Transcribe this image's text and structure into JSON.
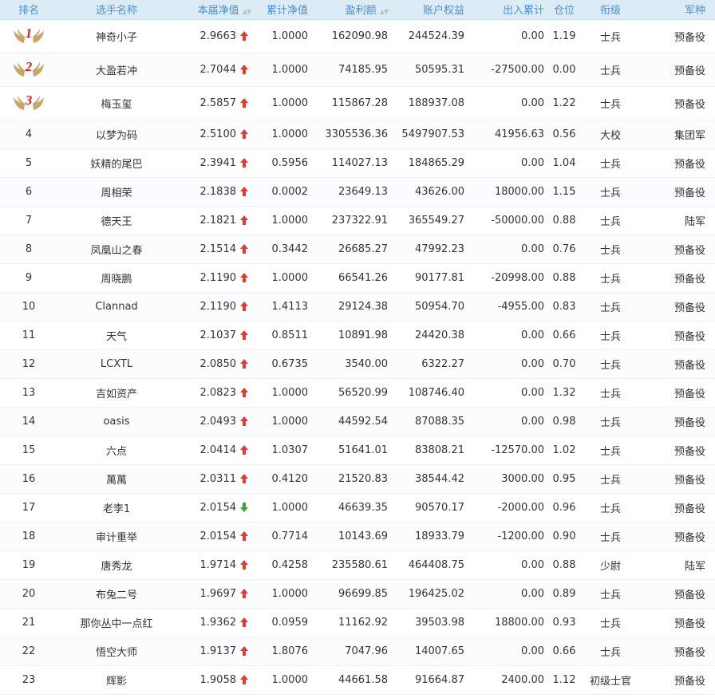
{
  "headers": {
    "rank": "排名",
    "name": "选手名称",
    "net_value": "本届净值",
    "cum_net_value": "累计净值",
    "profit": "盈利额",
    "equity": "账户权益",
    "inout": "出入累计",
    "position": "仓位",
    "title": "衔级",
    "army": "军种"
  },
  "colors": {
    "header_bg": "#dcecf7",
    "header_text": "#4a8fd6",
    "up_arrow": "#e8392a",
    "down_arrow": "#3aa53a",
    "medal": "#c9a56a",
    "medal_number": "#d02020"
  },
  "rows": [
    {
      "rank": "1",
      "name": "神奇小子",
      "net": "2.9663",
      "trend": "up",
      "cum": "1.0000",
      "profit": "162090.98",
      "equity": "244524.39",
      "inout": "0.00",
      "position": "1.19",
      "title": "士兵",
      "army": "预备役"
    },
    {
      "rank": "2",
      "name": "大盈若冲",
      "net": "2.7044",
      "trend": "up",
      "cum": "1.0000",
      "profit": "74185.95",
      "equity": "50595.31",
      "inout": "-27500.00",
      "position": "0.00",
      "title": "士兵",
      "army": "预备役"
    },
    {
      "rank": "3",
      "name": "梅玉玺",
      "net": "2.5857",
      "trend": "up",
      "cum": "1.0000",
      "profit": "115867.28",
      "equity": "188937.08",
      "inout": "0.00",
      "position": "1.22",
      "title": "士兵",
      "army": "预备役"
    },
    {
      "rank": "4",
      "name": "以梦为码",
      "net": "2.5100",
      "trend": "up",
      "cum": "1.0000",
      "profit": "3305536.36",
      "equity": "5497907.53",
      "inout": "41956.63",
      "position": "0.56",
      "title": "大校",
      "army": "集团军"
    },
    {
      "rank": "5",
      "name": "妖精的尾巴",
      "net": "2.3941",
      "trend": "up",
      "cum": "0.5956",
      "profit": "114027.13",
      "equity": "184865.29",
      "inout": "0.00",
      "position": "1.04",
      "title": "士兵",
      "army": "预备役"
    },
    {
      "rank": "6",
      "name": "周相荣",
      "net": "2.1838",
      "trend": "up",
      "cum": "0.0002",
      "profit": "23649.13",
      "equity": "43626.00",
      "inout": "18000.00",
      "position": "1.15",
      "title": "士兵",
      "army": "预备役"
    },
    {
      "rank": "7",
      "name": "德天王",
      "net": "2.1821",
      "trend": "up",
      "cum": "1.0000",
      "profit": "237322.91",
      "equity": "365549.27",
      "inout": "-50000.00",
      "position": "0.88",
      "title": "士兵",
      "army": "陆军"
    },
    {
      "rank": "8",
      "name": "凤凰山之春",
      "net": "2.1514",
      "trend": "up",
      "cum": "0.3442",
      "profit": "26685.27",
      "equity": "47992.23",
      "inout": "0.00",
      "position": "0.76",
      "title": "士兵",
      "army": "预备役"
    },
    {
      "rank": "9",
      "name": "周晓鹏",
      "net": "2.1190",
      "trend": "up",
      "cum": "1.0000",
      "profit": "66541.26",
      "equity": "90177.81",
      "inout": "-20998.00",
      "position": "0.88",
      "title": "士兵",
      "army": "预备役"
    },
    {
      "rank": "10",
      "name": "Clannad",
      "net": "2.1190",
      "trend": "up",
      "cum": "1.4113",
      "profit": "29124.38",
      "equity": "50954.70",
      "inout": "-4955.00",
      "position": "0.83",
      "title": "士兵",
      "army": "预备役"
    },
    {
      "rank": "11",
      "name": "天气",
      "net": "2.1037",
      "trend": "up",
      "cum": "0.8511",
      "profit": "10891.98",
      "equity": "24420.38",
      "inout": "0.00",
      "position": "0.66",
      "title": "士兵",
      "army": "预备役"
    },
    {
      "rank": "12",
      "name": "LCXTL",
      "net": "2.0850",
      "trend": "up",
      "cum": "0.6735",
      "profit": "3540.00",
      "equity": "6322.27",
      "inout": "0.00",
      "position": "0.70",
      "title": "士兵",
      "army": "预备役"
    },
    {
      "rank": "13",
      "name": "吉如资产",
      "net": "2.0823",
      "trend": "up",
      "cum": "1.0000",
      "profit": "56520.99",
      "equity": "108746.40",
      "inout": "0.00",
      "position": "1.32",
      "title": "士兵",
      "army": "预备役"
    },
    {
      "rank": "14",
      "name": "oasis",
      "net": "2.0493",
      "trend": "up",
      "cum": "1.0000",
      "profit": "44592.54",
      "equity": "87088.35",
      "inout": "0.00",
      "position": "0.98",
      "title": "士兵",
      "army": "预备役"
    },
    {
      "rank": "15",
      "name": "六点",
      "net": "2.0414",
      "trend": "up",
      "cum": "1.0307",
      "profit": "51641.01",
      "equity": "83808.21",
      "inout": "-12570.00",
      "position": "1.02",
      "title": "士兵",
      "army": "预备役"
    },
    {
      "rank": "16",
      "name": "萬萬",
      "net": "2.0311",
      "trend": "up",
      "cum": "0.4120",
      "profit": "21520.83",
      "equity": "38544.42",
      "inout": "3000.00",
      "position": "0.95",
      "title": "士兵",
      "army": "预备役"
    },
    {
      "rank": "17",
      "name": "老李1",
      "net": "2.0154",
      "trend": "down",
      "cum": "1.0000",
      "profit": "46639.35",
      "equity": "90570.17",
      "inout": "-2000.00",
      "position": "0.96",
      "title": "士兵",
      "army": "预备役"
    },
    {
      "rank": "18",
      "name": "审计重举",
      "net": "2.0154",
      "trend": "up",
      "cum": "0.7714",
      "profit": "10143.69",
      "equity": "18933.79",
      "inout": "-1200.00",
      "position": "0.90",
      "title": "士兵",
      "army": "预备役"
    },
    {
      "rank": "19",
      "name": "唐秀龙",
      "net": "1.9714",
      "trend": "up",
      "cum": "0.4258",
      "profit": "235580.61",
      "equity": "464408.75",
      "inout": "0.00",
      "position": "0.88",
      "title": "少尉",
      "army": "陆军"
    },
    {
      "rank": "20",
      "name": "布兔二号",
      "net": "1.9697",
      "trend": "up",
      "cum": "1.0000",
      "profit": "96699.85",
      "equity": "196425.02",
      "inout": "0.00",
      "position": "0.89",
      "title": "士兵",
      "army": "预备役"
    },
    {
      "rank": "21",
      "name": "那你丛中一点红",
      "net": "1.9362",
      "trend": "up",
      "cum": "0.0959",
      "profit": "11162.92",
      "equity": "39503.98",
      "inout": "18800.00",
      "position": "0.93",
      "title": "士兵",
      "army": "预备役"
    },
    {
      "rank": "22",
      "name": "悟空大师",
      "net": "1.9137",
      "trend": "up",
      "cum": "1.8076",
      "profit": "7047.96",
      "equity": "14007.65",
      "inout": "0.00",
      "position": "0.66",
      "title": "士兵",
      "army": "预备役"
    },
    {
      "rank": "23",
      "name": "辉影",
      "net": "1.9058",
      "trend": "up",
      "cum": "1.0000",
      "profit": "44661.58",
      "equity": "91664.87",
      "inout": "2400.00",
      "position": "1.12",
      "title": "初级士官",
      "army": "预备役"
    }
  ]
}
